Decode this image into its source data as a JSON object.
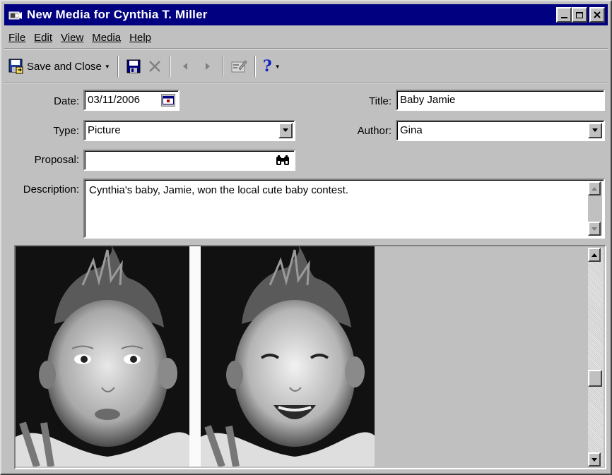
{
  "window": {
    "title": "New Media for Cynthia T. Miller",
    "controls": {
      "minimize": "_",
      "maximize": "□",
      "close": "×"
    }
  },
  "menu": [
    {
      "label": "File"
    },
    {
      "label": "Edit"
    },
    {
      "label": "View"
    },
    {
      "label": "Media"
    },
    {
      "label": "Help"
    }
  ],
  "toolbar": {
    "save_close_label": "Save and Close",
    "icons": [
      "save-close-icon",
      "save-icon",
      "delete-icon",
      "previous-icon",
      "next-icon",
      "properties-icon",
      "help-icon"
    ],
    "help_label": "?"
  },
  "form": {
    "date_label": "Date:",
    "date_value": "03/11/2006",
    "title_label": "Title:",
    "title_value": "Baby Jamie",
    "type_label": "Type:",
    "type_value": "Picture",
    "author_label": "Author:",
    "author_value": "Gina",
    "proposal_label": "Proposal:",
    "proposal_value": "",
    "description_label": "Description:",
    "description_value": "Cynthia's baby, Jamie, won the local cute baby contest."
  },
  "image": {
    "description": "",
    "scroll_position": 0.62
  },
  "colors": {
    "titlebar": "#000080",
    "window_bg": "#c0c0c0",
    "help_blue": "#1020c0"
  }
}
